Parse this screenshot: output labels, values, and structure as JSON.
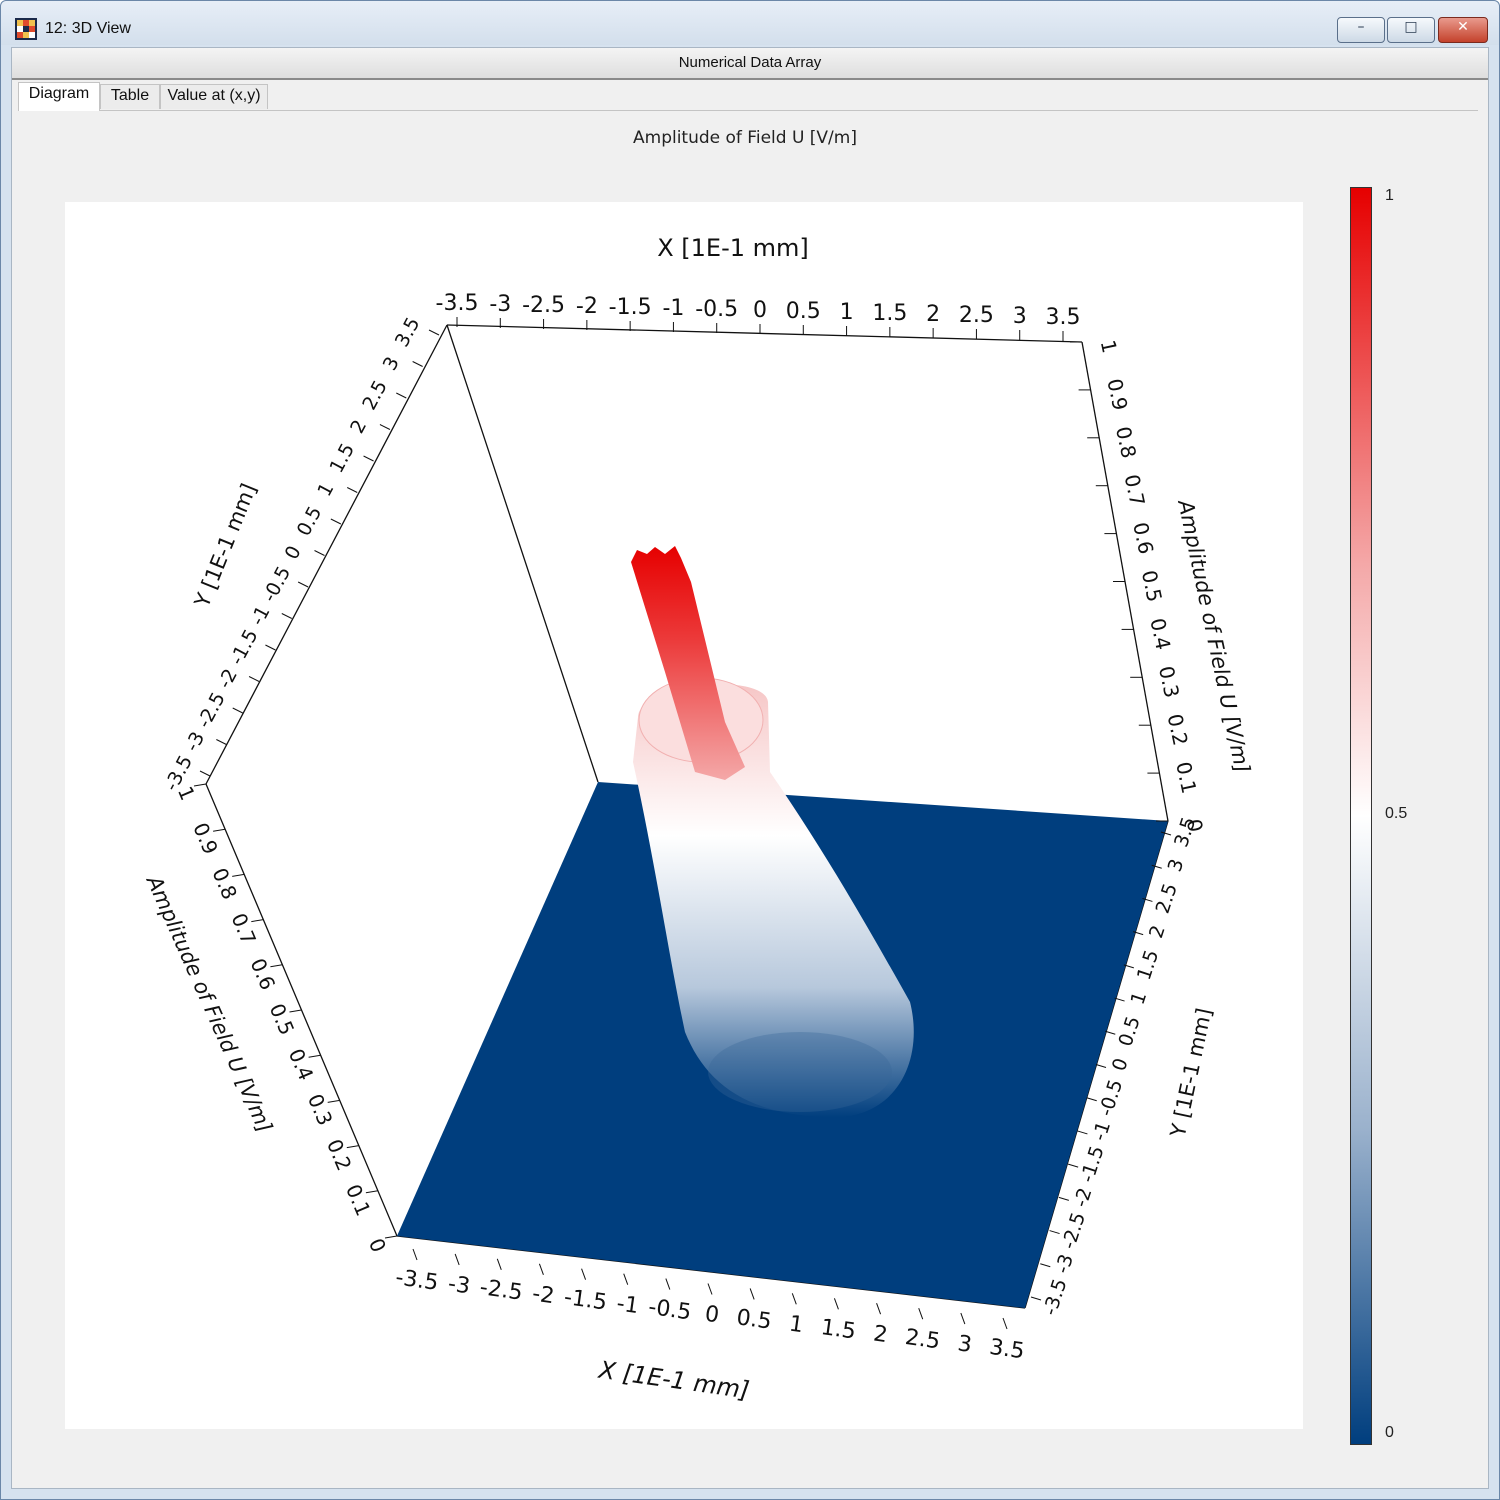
{
  "window": {
    "title": "12: 3D View",
    "minimize_glyph": "–",
    "maximize_glyph": "□",
    "close_glyph": "✕"
  },
  "panel": {
    "header": "Numerical Data Array"
  },
  "tabs": [
    {
      "label": "Diagram",
      "active": true
    },
    {
      "label": "Table",
      "active": false
    },
    {
      "label": "Value at (x,y)",
      "active": false
    }
  ],
  "chart_data": {
    "type": "surface3d",
    "title": "Amplitude of Field U  [V/m]",
    "x_axis": {
      "label": "X [1E-1 mm]",
      "ticks": [
        "-3.5",
        "-3",
        "-2.5",
        "-2",
        "-1.5",
        "-1",
        "-0.5",
        "0",
        "0.5",
        "1",
        "1.5",
        "2",
        "2.5",
        "3",
        "3.5"
      ],
      "range": [
        -3.5,
        3.5
      ]
    },
    "y_axis": {
      "label": "Y [1E-1 mm]",
      "ticks": [
        "-3.5",
        "-3",
        "-2.5",
        "-2",
        "-1.5",
        "-1",
        "-0.5",
        "0",
        "0.5",
        "1",
        "1.5",
        "2",
        "2.5",
        "3",
        "3.5"
      ],
      "range": [
        -3.5,
        3.5
      ]
    },
    "z_axis": {
      "label": "Amplitude of Field U  [V/m]",
      "ticks": [
        "0",
        "0.1",
        "0.2",
        "0.3",
        "0.4",
        "0.5",
        "0.6",
        "0.7",
        "0.8",
        "0.9",
        "1"
      ],
      "range": [
        0,
        1
      ]
    },
    "surface": {
      "description": "Narrow central peak of amplitude 1 at (0,0) surrounded by a ring of amplitude about 0.65, decaying to 0 beyond radius about 1.5",
      "peak_center": [
        0,
        0
      ],
      "peak_value": 1,
      "ring_value": 0.65,
      "base_value": 0
    },
    "colorbar": {
      "ticks": [
        "1",
        "0.5",
        "0"
      ],
      "colors": [
        "#e60000",
        "#ffffff",
        "#003e7e"
      ]
    }
  }
}
